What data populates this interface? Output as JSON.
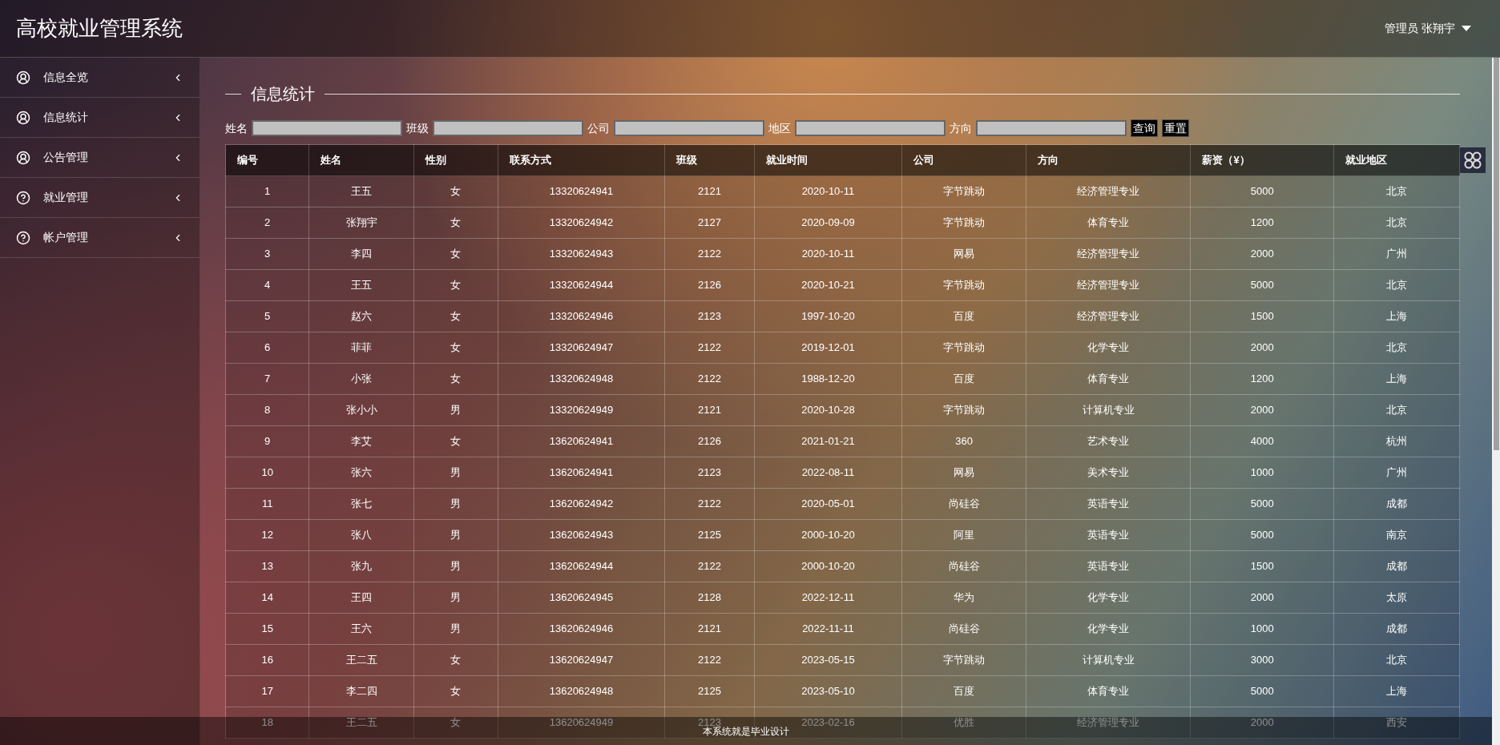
{
  "header": {
    "title": "高校就业管理系统",
    "user_menu": "管理员 张翔宇"
  },
  "sidebar": {
    "items": [
      {
        "label": "信息全览",
        "kind": "user"
      },
      {
        "label": "信息统计",
        "kind": "user"
      },
      {
        "label": "公告管理",
        "kind": "user"
      },
      {
        "label": "就业管理",
        "kind": "help"
      },
      {
        "label": "帐户管理",
        "kind": "help"
      }
    ]
  },
  "section_title": "信息统计",
  "filters": [
    {
      "label": "姓名"
    },
    {
      "label": "班级"
    },
    {
      "label": "公司"
    },
    {
      "label": "地区"
    },
    {
      "label": "方向"
    }
  ],
  "buttons": [
    "查询",
    "重置"
  ],
  "table": {
    "columns": [
      "编号",
      "姓名",
      "性别",
      "联系方式",
      "班级",
      "就业时间",
      "公司",
      "方向",
      "薪资（¥）",
      "就业地区"
    ],
    "rows": [
      [
        "1",
        "王五",
        "女",
        "13320624941",
        "2121",
        "2020-10-11",
        "字节跳动",
        "经济管理专业",
        "5000",
        "北京"
      ],
      [
        "2",
        "张翔宇",
        "女",
        "13320624942",
        "2127",
        "2020-09-09",
        "字节跳动",
        "体育专业",
        "1200",
        "北京"
      ],
      [
        "3",
        "李四",
        "女",
        "13320624943",
        "2122",
        "2020-10-11",
        "网易",
        "经济管理专业",
        "2000",
        "广州"
      ],
      [
        "4",
        "王五",
        "女",
        "13320624944",
        "2126",
        "2020-10-21",
        "字节跳动",
        "经济管理专业",
        "5000",
        "北京"
      ],
      [
        "5",
        "赵六",
        "女",
        "13320624946",
        "2123",
        "1997-10-20",
        "百度",
        "经济管理专业",
        "1500",
        "上海"
      ],
      [
        "6",
        "菲菲",
        "女",
        "13320624947",
        "2122",
        "2019-12-01",
        "字节跳动",
        "化学专业",
        "2000",
        "北京"
      ],
      [
        "7",
        "小张",
        "女",
        "13320624948",
        "2122",
        "1988-12-20",
        "百度",
        "体育专业",
        "1200",
        "上海"
      ],
      [
        "8",
        "张小小",
        "男",
        "13320624949",
        "2121",
        "2020-10-28",
        "字节跳动",
        "计算机专业",
        "2000",
        "北京"
      ],
      [
        "9",
        "李艾",
        "女",
        "13620624941",
        "2126",
        "2021-01-21",
        "360",
        "艺术专业",
        "4000",
        "杭州"
      ],
      [
        "10",
        "张六",
        "男",
        "13620624941",
        "2123",
        "2022-08-11",
        "网易",
        "美术专业",
        "1000",
        "广州"
      ],
      [
        "11",
        "张七",
        "男",
        "13620624942",
        "2122",
        "2020-05-01",
        "尚硅谷",
        "英语专业",
        "5000",
        "成都"
      ],
      [
        "12",
        "张八",
        "男",
        "13620624943",
        "2125",
        "2000-10-20",
        "阿里",
        "英语专业",
        "5000",
        "南京"
      ],
      [
        "13",
        "张九",
        "男",
        "13620624944",
        "2122",
        "2000-10-20",
        "尚硅谷",
        "英语专业",
        "1500",
        "成都"
      ],
      [
        "14",
        "王四",
        "男",
        "13620624945",
        "2128",
        "2022-12-11",
        "华为",
        "化学专业",
        "2000",
        "太原"
      ],
      [
        "15",
        "王六",
        "男",
        "13620624946",
        "2121",
        "2022-11-11",
        "尚硅谷",
        "化学专业",
        "1000",
        "成都"
      ],
      [
        "16",
        "王二五",
        "女",
        "13620624947",
        "2122",
        "2023-05-15",
        "字节跳动",
        "计算机专业",
        "3000",
        "北京"
      ],
      [
        "17",
        "李二四",
        "女",
        "13620624948",
        "2125",
        "2023-05-10",
        "百度",
        "体育专业",
        "5000",
        "上海"
      ],
      [
        "18",
        "王二五",
        "女",
        "13620624949",
        "2123",
        "2023-02-16",
        "优胜",
        "经济管理专业",
        "2000",
        "西安"
      ]
    ]
  },
  "footer": "本系统就是毕业设计"
}
